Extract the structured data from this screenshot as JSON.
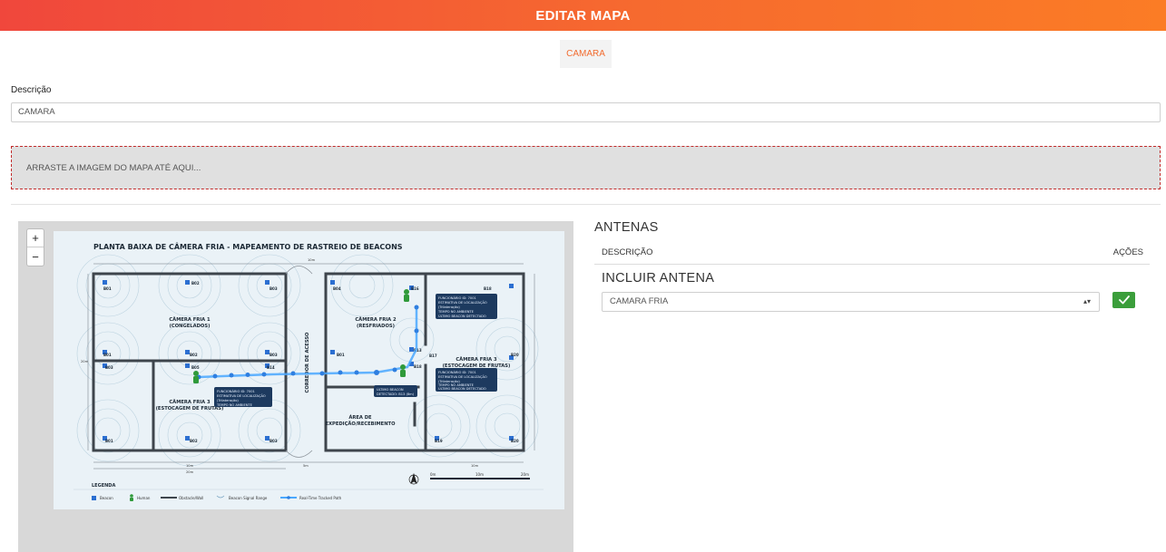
{
  "header": {
    "title": "EDITAR MAPA"
  },
  "tabs": [
    {
      "label": "CAMARA"
    }
  ],
  "form": {
    "description_label": "Descrição",
    "description_value": "CAMARA",
    "dropzone_text": "ARRASTE A IMAGEM DO MAPA ATÉ AQUI..."
  },
  "map": {
    "zoom_in": "+",
    "zoom_out": "−",
    "plan": {
      "title": "PLANTA BAIXA DE CÂMERA FRIA - MAPEAMENTO DE RASTREIO DE BEACONS",
      "rooms": {
        "room1_line1": "CÂMERA FRIA 1",
        "room1_line2": "(CONGELADOS)",
        "room2_line1": "CÂMERA FRIA 2",
        "room2_line2": "(RESFRIADOS)",
        "room3_line1": "CÂMERA FRIA 3",
        "room3_line2": "(ESTOCAGEM DE FRUTAS)",
        "room3r_line1": "CÂMERA FRIA 3",
        "room3r_line2": "(ESTOCAGEM DE FRUTAS)",
        "corridor": "CORREDOR DE ACESSO",
        "area_line1": "ÁREA DE",
        "area_line2": "EXPEDIÇÃO/RECEBIMENTO"
      },
      "beacons": [
        "B01",
        "B02",
        "B03",
        "B04",
        "B01",
        "B16",
        "B18",
        "B03",
        "B02",
        "B03",
        "B05",
        "B14",
        "B13",
        "B17",
        "B20",
        "B18",
        "B01",
        "B02",
        "B03",
        "B19",
        "B20"
      ],
      "legend": {
        "title": "LEGENDA",
        "items": [
          "Beacon",
          "Human",
          "Obstacle/Wall",
          "Beacon Signal Range",
          "Real-Time Tracked Path"
        ]
      },
      "scale": [
        "0m",
        "10m",
        "20m"
      ],
      "dims": {
        "top": "10m",
        "left": "20m",
        "bottom_left": "10m",
        "bottom_mid": "20m",
        "bottom_corr": "5m",
        "bottom_right": "10m"
      },
      "tags": {
        "t1": [
          "FUNCIONÁRIO ID: 7001",
          "ESTIMATIVA DE LOCALIZAÇÃO",
          "(Trilateração)",
          "TEMPO NO AMBIENTE",
          "ÚLTIMO BEACON DETECTADO"
        ],
        "t2": [
          "FUNCIONÁRIO ID: 7001",
          "ESTIMATIVA DE LOCALIZAÇÃO",
          "(Trilateração)",
          "TEMPO NO AMBIENTE"
        ],
        "t3": [
          "ÚLTIMO BEACON",
          "DETECTADO: B13 (8m)"
        ],
        "t4": [
          "FUNCIONÁRIO ID: 7001",
          "ESTIMATIVA DE LOCALIZAÇÃO",
          "(Trilateração)",
          "TEMPO NO AMBIENTE",
          "ÚLTIMO BEACON DETECTADO"
        ]
      }
    }
  },
  "antennas": {
    "title": "ANTENAS",
    "col_description": "DESCRIÇÃO",
    "col_actions": "AÇÕES",
    "include_title": "INCLUIR ANTENA",
    "select_value": "CAMARA FRIA",
    "caret": "▴▾"
  },
  "colors": {
    "accent": "#f26b2f",
    "header_start": "#f0473c",
    "header_end": "#fb7c25",
    "ok": "#3b9e3b",
    "dropzone_border": "#c22a2a"
  }
}
